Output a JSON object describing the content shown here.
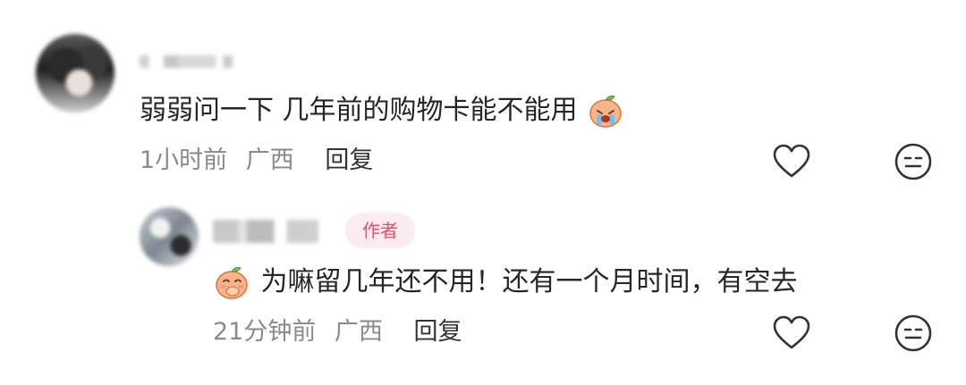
{
  "comment": {
    "text": "弱弱问一下 几年前的购物卡能不能用",
    "text_emoji": "crying-peach-emoji",
    "time": "1小时前",
    "location": "广西",
    "reply_label": "回复",
    "like_icon": "heart-icon",
    "react_icon": "neutral-face-icon"
  },
  "reply": {
    "badge": "作者",
    "text": "为嘛留几年还不用！还有一个月时间，有空去",
    "text_emoji": "peach-hand-over-mouth-emoji",
    "time": "21分钟前",
    "location": "广西",
    "reply_label": "回复",
    "like_icon": "heart-icon",
    "react_icon": "neutral-face-icon"
  },
  "colors": {
    "badge_text": "#ee4966",
    "badge_bg": "#fdecef",
    "meta_text": "#8a8a8a",
    "body_text": "#262626"
  }
}
